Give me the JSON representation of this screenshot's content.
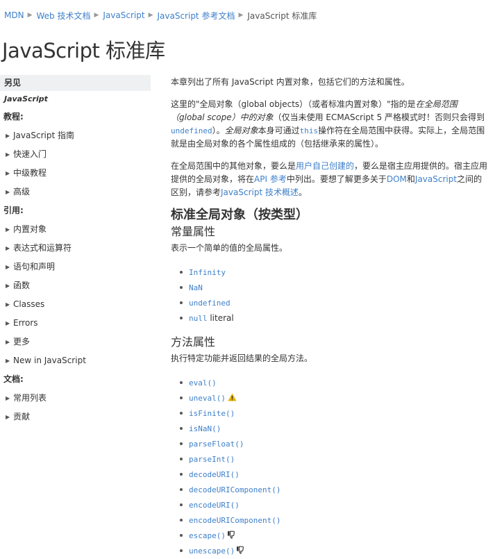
{
  "breadcrumb": {
    "items": [
      "MDN",
      "Web 技术文档",
      "JavaScript",
      "JavaScript 参考文档"
    ],
    "current": "JavaScript 标准库",
    "separator": "▶"
  },
  "page_title": "JavaScript 标准库",
  "sidebar": {
    "see_also": "另见",
    "sub": "JavaScript",
    "tutorials_label": "教程",
    "tutorials": [
      "JavaScript 指南",
      "快速入门",
      "中级教程",
      "高级"
    ],
    "reference_label": "引用",
    "reference": [
      "内置对象",
      "表达式和运算符",
      "语句和声明",
      "函数",
      "Classes",
      "Errors",
      "更多",
      "New in JavaScript"
    ],
    "docs_label": "文档",
    "docs": [
      "常用列表",
      "贡献"
    ]
  },
  "main": {
    "intro": "本章列出了所有 JavaScript 内置对象，包括它们的方法和属性。",
    "p2": {
      "t1": "这里的\"全局对象（global objects）（或者标准内置对象）\"指的是",
      "em1": "在全局范围（global scope）中的对象",
      "t2": "（仅当未使用 ECMAScript 5 严格模式时！否则只会得到",
      "code1": "undefined",
      "t3": "）。",
      "em2": "全局对象",
      "t4": "本身可通过",
      "code2": "this",
      "t5": "操作符在全局范围中获得。实际上，全局范围就是由全局对象的各个属性组成的（包括继承来的属性）。"
    },
    "p3": {
      "t1": "在全局范围中的其他对象，要么是",
      "link1": "用户自己创建的",
      "t2": "，要么是宿主应用提供的。宿主应用提供的全局对象，将在",
      "link2": "API 参考",
      "t3": "中列出。要想了解更多关于",
      "link3": "DOM",
      "t4": "和",
      "link4": "JavaScript",
      "t5": "之间的区别，请参考",
      "link5": "JavaScript 技术概述",
      "t6": "。"
    },
    "h2": "标准全局对象（按类型）",
    "value_props": {
      "heading": "常量属性",
      "desc": "表示一个简单的值的全局属性。",
      "items": [
        "Infinity",
        "NaN",
        "undefined",
        "null"
      ],
      "null_suffix": " literal"
    },
    "func_props": {
      "heading": "方法属性",
      "desc": "执行特定功能并返回结果的全局方法。",
      "items": [
        "eval()",
        "uneval()",
        "isFinite()",
        "isNaN()",
        "parseFloat()",
        "parseInt()",
        "decodeURI()",
        "decodeURIComponent()",
        "encodeURI()",
        "encodeURIComponent()",
        "escape()",
        "unescape()"
      ]
    }
  },
  "colors": {
    "link": "#3d7fc9",
    "sidebar_head_bg": "#eef0f1",
    "warning": "#e6b300"
  },
  "icons": {
    "breadcrumb_separator": "chevron-right-icon",
    "experimental": "warning-icon",
    "deprecated": "thumbs-down-icon",
    "expand": "triangle-right-icon"
  }
}
